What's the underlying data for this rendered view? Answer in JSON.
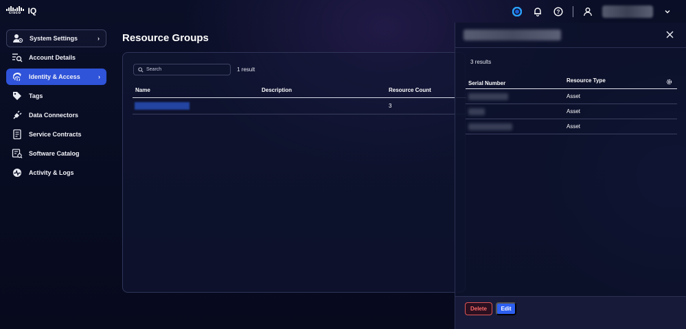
{
  "app": {
    "logo_text": "cisco",
    "product": "IQ"
  },
  "header": {
    "icons": [
      "status-icon",
      "bell-icon",
      "help-icon",
      "user-icon",
      "chevron-down-icon"
    ]
  },
  "sidebar": {
    "items": [
      {
        "label": "System Settings",
        "icon": "user-gear-icon"
      },
      {
        "label": "Account Details",
        "icon": "list-search-icon"
      },
      {
        "label": "Identity & Access",
        "icon": "fingerprint-icon",
        "active": true
      },
      {
        "label": "Tags",
        "icon": "tag-icon"
      },
      {
        "label": "Data Connectors",
        "icon": "plug-icon"
      },
      {
        "label": "Service Contracts",
        "icon": "contract-icon"
      },
      {
        "label": "Software Catalog",
        "icon": "catalog-icon"
      },
      {
        "label": "Activity & Logs",
        "icon": "activity-icon"
      }
    ]
  },
  "main": {
    "title": "Resource Groups",
    "search_placeholder": "Search",
    "result_count": "1 result",
    "columns": [
      "Name",
      "Description",
      "Resource Count"
    ],
    "rows": [
      {
        "name": "",
        "description": "",
        "count": "3"
      }
    ]
  },
  "drawer": {
    "result_count": "3 results",
    "columns": [
      "Serial Number",
      "Resource Type"
    ],
    "rows": [
      {
        "serial": "",
        "type": "Asset"
      },
      {
        "serial": "",
        "type": "Asset"
      },
      {
        "serial": "",
        "type": "Asset"
      }
    ],
    "delete_label": "Delete",
    "edit_label": "Edit"
  },
  "colors": {
    "accent": "#2f53d9",
    "danger": "#e05555",
    "background": "#0a0f27"
  }
}
